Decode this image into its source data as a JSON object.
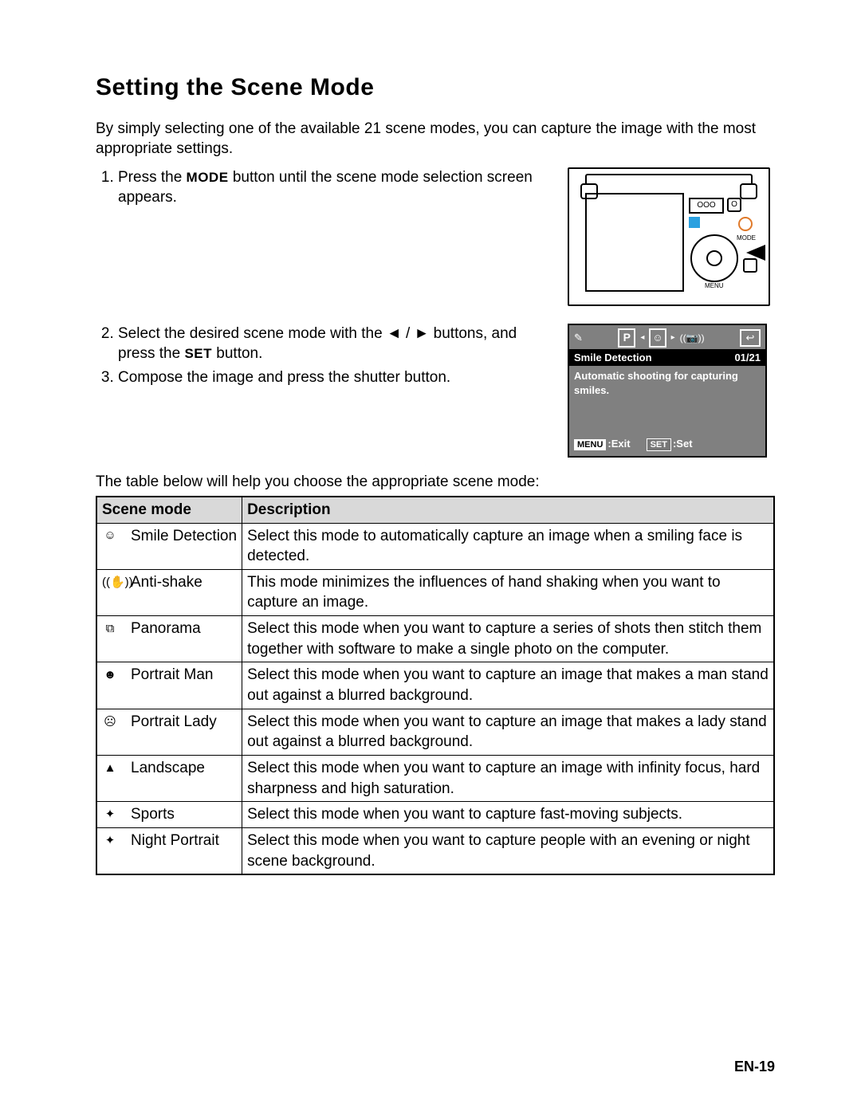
{
  "heading": "Setting the Scene Mode",
  "intro": "By simply selecting one of the available 21 scene modes, you can capture the image with the most appropriate settings.",
  "steps": {
    "s1_a": "Press the ",
    "s1_mode": "MODE",
    "s1_b": " button until the scene mode selection screen appears.",
    "s2_a": "Select the desired scene mode with the ",
    "s2_arrows": "◄ / ►",
    "s2_b": " buttons, and press the ",
    "s2_set": "SET",
    "s2_c": " button.",
    "s3": "Compose the image and press the shutter button."
  },
  "camera": {
    "badge": "OOO",
    "dot": "O",
    "mode_lbl": "MODE",
    "menu_lbl": "MENU"
  },
  "lcd": {
    "p_icon": "P",
    "smile_icon": "☺",
    "shake_icon": "((📷))",
    "ret_icon": "↩",
    "leaf_icon": "✎",
    "tri_l": "◂",
    "tri_r": "▸",
    "title": "Smile Detection",
    "counter": "01/21",
    "desc": "Automatic shooting for capturing smiles.",
    "menu_btn": "MENU",
    "menu_lbl": ":Exit",
    "set_btn": "SET",
    "set_lbl": ":Set"
  },
  "table_intro": "The table below will help you choose the appropriate scene mode:",
  "table": {
    "head": {
      "c1": "Scene mode",
      "c2": "Description"
    },
    "rows": [
      {
        "icon": "☺",
        "name": "Smile Detection",
        "desc": "Select this mode to automatically capture an image when a smiling face is detected."
      },
      {
        "icon": "((✋))",
        "name": "Anti-shake",
        "desc": "This mode minimizes the influences of hand shaking when you want to capture an image."
      },
      {
        "icon": "⧉",
        "name": "Panorama",
        "desc": "Select this mode when you want to capture a series of shots then stitch them together with software to make a single photo on the computer."
      },
      {
        "icon": "☻",
        "name": "Portrait Man",
        "desc": "Select this mode when you want to capture an image that makes a man stand out against a blurred background."
      },
      {
        "icon": "☹",
        "name": "Portrait Lady",
        "desc": "Select this mode when you want to capture an image that makes a lady stand out against a blurred background."
      },
      {
        "icon": "▲",
        "name": "Landscape",
        "desc": "Select this mode when you want to capture an image with infinity focus, hard sharpness and high saturation."
      },
      {
        "icon": "✦",
        "name": "Sports",
        "desc": "Select this mode when you want to capture fast-moving subjects."
      },
      {
        "icon": "✦",
        "name": "Night Portrait",
        "desc": "Select this mode when you want to capture people with an evening or night scene background."
      }
    ]
  },
  "page_num": "EN-19"
}
